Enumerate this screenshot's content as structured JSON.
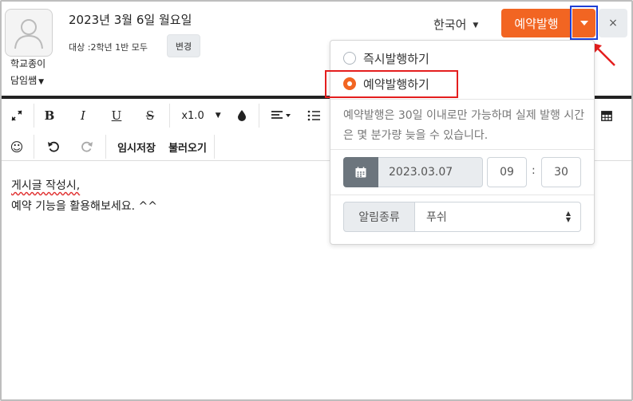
{
  "header": {
    "author_name": "학교종이",
    "author_role": "담임쌤",
    "post_date": "2023년 3월 6일 월요일",
    "audience": "대상 :2학년 1반 모두",
    "change_label": "변경",
    "language": "한국어",
    "reserve_publish_label": "예약발행",
    "close_label": "×"
  },
  "toolbar": {
    "zoom_value": "x1.0",
    "temp_save_label": "임시저장",
    "load_label": "불러오기"
  },
  "editor": {
    "line1": "게시글 작성시,",
    "line2": "예약 기능을 활용해보세요. ^^"
  },
  "publish_menu": {
    "option_immediate": "즉시발행하기",
    "option_scheduled": "예약발행하기",
    "selected": "예약발행하기",
    "info_text": "예약발행은 30일 이내로만 가능하며 실제 발행 시간은 몇 분가량 늦을 수 있습니다.",
    "date_value": "2023.03.07",
    "hour_value": "09",
    "minute_value": "30",
    "alarm_label": "알림종류",
    "alarm_value": "푸쉬"
  },
  "colors": {
    "accent": "#f26522",
    "highlight_blue": "#1f3fd6",
    "highlight_red": "#e41e1e"
  },
  "icons": [
    "user-avatar-icon",
    "expand-icon",
    "bold-icon",
    "italic-icon",
    "underline-icon",
    "strikethrough-icon",
    "ink-drop-icon",
    "align-icon",
    "list-icon",
    "table-icon",
    "emoji-icon",
    "undo-icon",
    "redo-icon",
    "calendar-icon",
    "caret-down-icon",
    "close-icon",
    "arrow-annotation-icon"
  ]
}
